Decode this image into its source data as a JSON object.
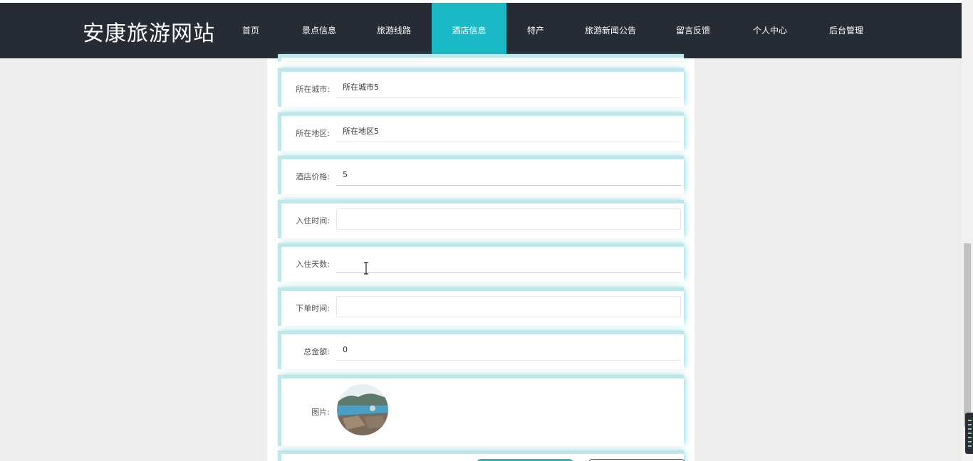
{
  "brand": "安康旅游网站",
  "nav": [
    {
      "label": "首页",
      "active": false
    },
    {
      "label": "景点信息",
      "active": false
    },
    {
      "label": "旅游线路",
      "active": false
    },
    {
      "label": "酒店信息",
      "active": true
    },
    {
      "label": "特产",
      "active": false
    },
    {
      "label": "旅游新闻公告",
      "active": false
    },
    {
      "label": "留言反馈",
      "active": false
    },
    {
      "label": "个人中心",
      "active": false
    },
    {
      "label": "后台管理",
      "active": false
    }
  ],
  "form": {
    "city": {
      "label": "所在城市:",
      "value": "所在城市5"
    },
    "district": {
      "label": "所在地区:",
      "value": "所在地区5"
    },
    "price": {
      "label": "酒店价格:",
      "value": "5"
    },
    "checkin_time": {
      "label": "入住时间:",
      "value": ""
    },
    "days": {
      "label": "入住天数:",
      "value": ""
    },
    "order_time": {
      "label": "下单时间:",
      "value": ""
    },
    "total": {
      "label": "总金额:",
      "value": "0"
    },
    "image": {
      "label": "图片:"
    }
  },
  "colors": {
    "accent": "#1bb8c6",
    "navbar": "#272b33",
    "background": "#eeeeee"
  }
}
